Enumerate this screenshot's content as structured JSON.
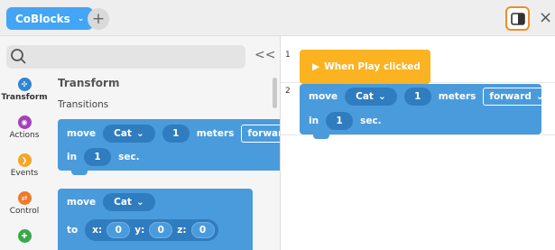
{
  "topbar": {
    "project_tab": "CoBlocks",
    "add_label": "+",
    "close_label": "×"
  },
  "palette": {
    "collapse_label": "<<",
    "categories": [
      {
        "label": "Transform",
        "color": "#2f86d4"
      },
      {
        "label": "Actions",
        "color": "#a63fb8"
      },
      {
        "label": "Events",
        "color": "#f5a623"
      },
      {
        "label": "Control",
        "color": "#f07a2b"
      },
      {
        "label": "",
        "color": "#3aa84a"
      }
    ],
    "section_title": "Transform",
    "section_subtitle": "Transitions",
    "move_block": {
      "move": "move",
      "object": "Cat",
      "amount": "1",
      "unit": "meters",
      "direction": "forward",
      "in": "in",
      "duration": "1",
      "sec": "sec."
    },
    "move_to_block": {
      "move": "move",
      "object": "Cat",
      "to": "to",
      "x_label": "x:",
      "x": "0",
      "y_label": "y:",
      "y": "0",
      "z_label": "z:",
      "z": "0"
    }
  },
  "script": {
    "line1": "1",
    "line2": "2",
    "event_label": "When Play clicked",
    "move_block": {
      "move": "move",
      "object": "Cat",
      "amount": "1",
      "unit": "meters",
      "direction": "forward",
      "in": "in",
      "duration": "1",
      "sec": "sec."
    }
  }
}
